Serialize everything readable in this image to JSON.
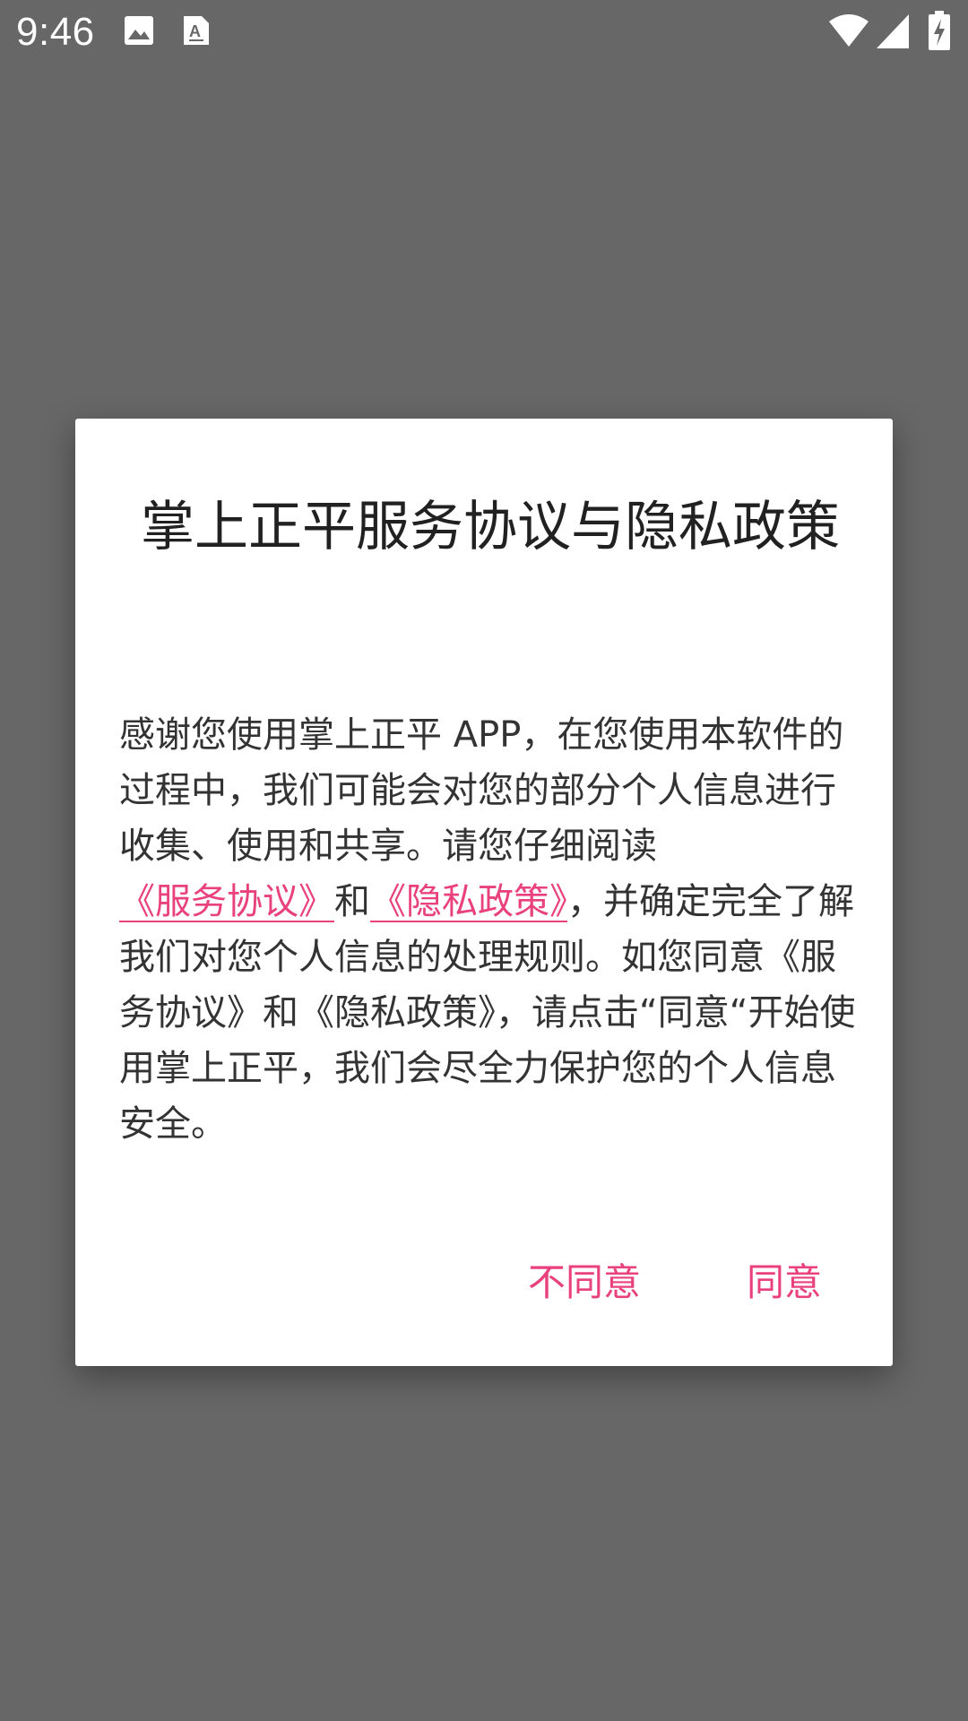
{
  "status_bar": {
    "time": "9:46",
    "icons": [
      "image-notification-icon",
      "a-font-notification-icon",
      "wifi-icon",
      "cell-signal-icon",
      "battery-charging-icon"
    ]
  },
  "dialog": {
    "title": "掌上正平服务协议与隐私政策",
    "body": {
      "text_1": "感谢您使用掌上正平 APP，在您使用本软件的过程中，我们可能会对您的部分个人信息进行收集、使用和共享。请您仔细阅读",
      "link_service": "《服务协议》",
      "text_2": "和",
      "link_privacy": "《隐私政策》",
      "text_3": "，并确定完全了解我们对您个人信息的处理规则。如您同意《服务协议》和《隐私政策》，请点击“同意“开始使用掌上正平，我们会尽全力保护您的个人信息安全。"
    },
    "buttons": {
      "disagree": "不同意",
      "agree": "同意"
    }
  },
  "colors": {
    "scrim": "#676767",
    "accent": "#e8417c",
    "dialog_bg": "#ffffff",
    "title_text": "#212121",
    "body_text": "#333333"
  }
}
